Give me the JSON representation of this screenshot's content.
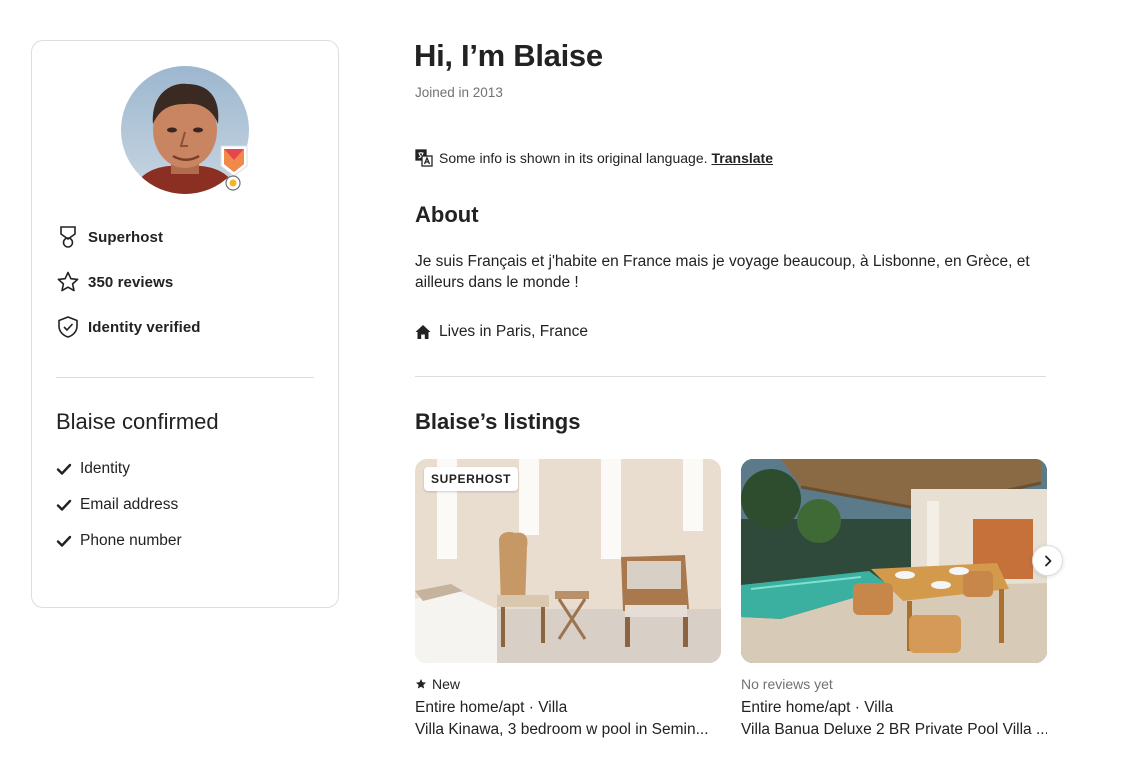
{
  "profile": {
    "stats": [
      {
        "icon": "superhost-medal-icon",
        "label": "Superhost"
      },
      {
        "icon": "star-icon",
        "label": "350 reviews"
      },
      {
        "icon": "shield-check-icon",
        "label": "Identity verified"
      }
    ],
    "confirmed_title": "Blaise confirmed",
    "confirmed_items": [
      "Identity",
      "Email address",
      "Phone number"
    ]
  },
  "header": {
    "greeting": "Hi, I’m Blaise",
    "joined": "Joined in 2013"
  },
  "translation": {
    "note": "Some info is shown in its original language.",
    "link": "Translate"
  },
  "about": {
    "title": "About",
    "text": "Je suis Français et j'habite en France mais je voyage beaucoup, à Lisbonne, en Grèce, et ailleurs dans le monde !",
    "lives_in": "Lives in Paris, France"
  },
  "listings": {
    "title": "Blaise’s listings",
    "items": [
      {
        "badge": "SUPERHOST",
        "rating": "New",
        "type": "Entire home/apt · Villa",
        "name": "Villa Kinawa, 3 bedroom w pool in Semin..."
      },
      {
        "rating": "No reviews yet",
        "type": "Entire home/apt · Villa",
        "name": "Villa Banua Deluxe 2 BR Private Pool Villa ..."
      }
    ]
  },
  "colors": {
    "text": "#222222",
    "muted": "#717171",
    "border": "#dddddd",
    "superhost_badge": "#e8464e"
  }
}
